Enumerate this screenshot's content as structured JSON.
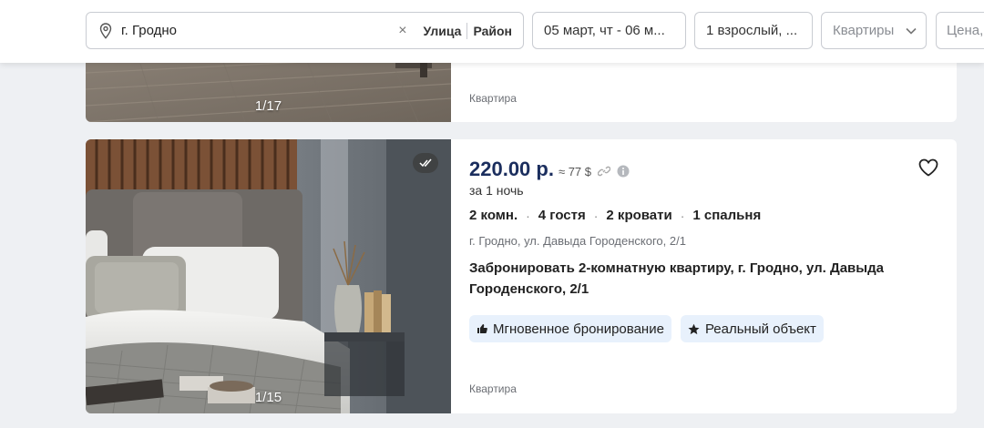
{
  "search": {
    "city": "г. Гродно",
    "clear_icon": "×",
    "street_label": "Улица",
    "district_label": "Район",
    "dates": "05 март, чт - 06 м...",
    "guests": "1 взрослый, ...",
    "type": "Квартиры",
    "price": "Цена,"
  },
  "previous_listing": {
    "photo_counter": "1/17",
    "type_label": "Квартира"
  },
  "listing": {
    "photo_counter": "1/15",
    "price": "220.00 р.",
    "price_usd": "≈ 77 $",
    "per_night": "за 1 ночь",
    "features": [
      "2 комн.",
      "4 гостя",
      "2 кровати",
      "1 спальня"
    ],
    "address": "г. Гродно, ул. Давыда Городенского, 2/1",
    "title": "Забронировать 2-комнатную квартиру, г. Гродно, ул. Давыда Городенского, 2/1",
    "tags": [
      "Мгновенное бронирование",
      "Реальный объект"
    ],
    "type_label": "Квартира"
  },
  "colors": {
    "price": "#1b2e5e",
    "tag_background": "#e8f1fc",
    "page_background": "#eef0f3"
  },
  "icons": {
    "city_field": "location-pin-icon",
    "price_link": "link-icon",
    "price_info": "info-icon",
    "verified": "double-check-icon",
    "favorite": "heart-icon",
    "instant_booking": "thumbs-up-icon",
    "real_object": "star-icon"
  }
}
